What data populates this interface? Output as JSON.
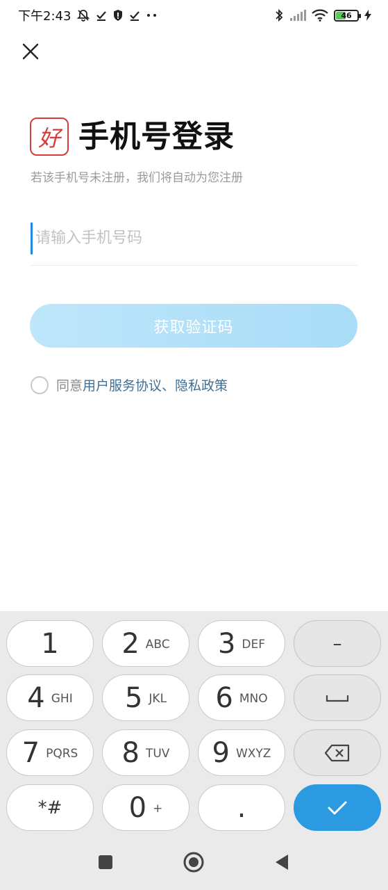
{
  "status_bar": {
    "time": "下午2:43",
    "battery_level": "46",
    "battery_color": "#5ac85a",
    "icons_left": [
      "mute-bell-icon",
      "check-icon",
      "shield-icon",
      "check-icon",
      "more-dots-icon"
    ],
    "icons_right": [
      "bluetooth-icon",
      "signal-icon",
      "wifi-icon",
      "battery-icon",
      "charging-icon"
    ]
  },
  "header": {
    "logo_text": "好",
    "title": "手机号登录",
    "subtitle": "若该手机号未注册，我们将自动为您注册"
  },
  "phone_input": {
    "placeholder": "请输入手机号码",
    "value": ""
  },
  "code_button": {
    "label": "获取验证码"
  },
  "agreement": {
    "prefix": "同意",
    "terms_link": "用户服务协议",
    "separator": "、",
    "privacy_link": "隐私政策",
    "checked": false
  },
  "keyboard": {
    "keys": [
      {
        "num": "1",
        "letters": ""
      },
      {
        "num": "2",
        "letters": "ABC"
      },
      {
        "num": "3",
        "letters": "DEF"
      },
      {
        "num": "4",
        "letters": "GHI"
      },
      {
        "num": "5",
        "letters": "JKL"
      },
      {
        "num": "6",
        "letters": "MNO"
      },
      {
        "num": "7",
        "letters": "PQRS"
      },
      {
        "num": "8",
        "letters": "TUV"
      },
      {
        "num": "9",
        "letters": "WXYZ"
      },
      {
        "num": "*#",
        "letters": ""
      },
      {
        "num": "0",
        "letters": "+"
      },
      {
        "num": ".",
        "letters": ""
      }
    ],
    "minus_label": "–",
    "confirm_color": "#2b9ae0"
  },
  "colors": {
    "accent": "#2b9ae0",
    "link": "#3d6f96",
    "logo_red": "#d83b3b",
    "button_disabled": "#bfe6fb"
  }
}
